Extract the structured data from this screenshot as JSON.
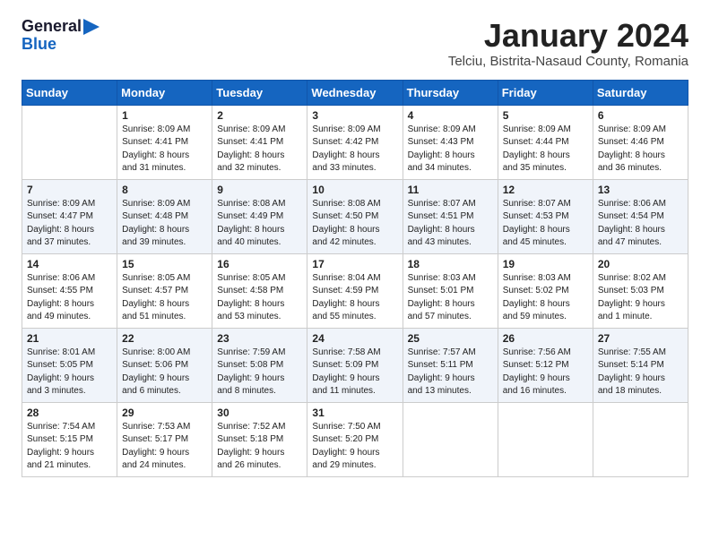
{
  "logo": {
    "line1": "General",
    "line2": "Blue"
  },
  "title": "January 2024",
  "location": "Telciu, Bistrita-Nasaud County, Romania",
  "headers": [
    "Sunday",
    "Monday",
    "Tuesday",
    "Wednesday",
    "Thursday",
    "Friday",
    "Saturday"
  ],
  "weeks": [
    [
      {
        "day": "",
        "info": ""
      },
      {
        "day": "1",
        "info": "Sunrise: 8:09 AM\nSunset: 4:41 PM\nDaylight: 8 hours\nand 31 minutes."
      },
      {
        "day": "2",
        "info": "Sunrise: 8:09 AM\nSunset: 4:41 PM\nDaylight: 8 hours\nand 32 minutes."
      },
      {
        "day": "3",
        "info": "Sunrise: 8:09 AM\nSunset: 4:42 PM\nDaylight: 8 hours\nand 33 minutes."
      },
      {
        "day": "4",
        "info": "Sunrise: 8:09 AM\nSunset: 4:43 PM\nDaylight: 8 hours\nand 34 minutes."
      },
      {
        "day": "5",
        "info": "Sunrise: 8:09 AM\nSunset: 4:44 PM\nDaylight: 8 hours\nand 35 minutes."
      },
      {
        "day": "6",
        "info": "Sunrise: 8:09 AM\nSunset: 4:46 PM\nDaylight: 8 hours\nand 36 minutes."
      }
    ],
    [
      {
        "day": "7",
        "info": "Sunrise: 8:09 AM\nSunset: 4:47 PM\nDaylight: 8 hours\nand 37 minutes."
      },
      {
        "day": "8",
        "info": "Sunrise: 8:09 AM\nSunset: 4:48 PM\nDaylight: 8 hours\nand 39 minutes."
      },
      {
        "day": "9",
        "info": "Sunrise: 8:08 AM\nSunset: 4:49 PM\nDaylight: 8 hours\nand 40 minutes."
      },
      {
        "day": "10",
        "info": "Sunrise: 8:08 AM\nSunset: 4:50 PM\nDaylight: 8 hours\nand 42 minutes."
      },
      {
        "day": "11",
        "info": "Sunrise: 8:07 AM\nSunset: 4:51 PM\nDaylight: 8 hours\nand 43 minutes."
      },
      {
        "day": "12",
        "info": "Sunrise: 8:07 AM\nSunset: 4:53 PM\nDaylight: 8 hours\nand 45 minutes."
      },
      {
        "day": "13",
        "info": "Sunrise: 8:06 AM\nSunset: 4:54 PM\nDaylight: 8 hours\nand 47 minutes."
      }
    ],
    [
      {
        "day": "14",
        "info": "Sunrise: 8:06 AM\nSunset: 4:55 PM\nDaylight: 8 hours\nand 49 minutes."
      },
      {
        "day": "15",
        "info": "Sunrise: 8:05 AM\nSunset: 4:57 PM\nDaylight: 8 hours\nand 51 minutes."
      },
      {
        "day": "16",
        "info": "Sunrise: 8:05 AM\nSunset: 4:58 PM\nDaylight: 8 hours\nand 53 minutes."
      },
      {
        "day": "17",
        "info": "Sunrise: 8:04 AM\nSunset: 4:59 PM\nDaylight: 8 hours\nand 55 minutes."
      },
      {
        "day": "18",
        "info": "Sunrise: 8:03 AM\nSunset: 5:01 PM\nDaylight: 8 hours\nand 57 minutes."
      },
      {
        "day": "19",
        "info": "Sunrise: 8:03 AM\nSunset: 5:02 PM\nDaylight: 8 hours\nand 59 minutes."
      },
      {
        "day": "20",
        "info": "Sunrise: 8:02 AM\nSunset: 5:03 PM\nDaylight: 9 hours\nand 1 minute."
      }
    ],
    [
      {
        "day": "21",
        "info": "Sunrise: 8:01 AM\nSunset: 5:05 PM\nDaylight: 9 hours\nand 3 minutes."
      },
      {
        "day": "22",
        "info": "Sunrise: 8:00 AM\nSunset: 5:06 PM\nDaylight: 9 hours\nand 6 minutes."
      },
      {
        "day": "23",
        "info": "Sunrise: 7:59 AM\nSunset: 5:08 PM\nDaylight: 9 hours\nand 8 minutes."
      },
      {
        "day": "24",
        "info": "Sunrise: 7:58 AM\nSunset: 5:09 PM\nDaylight: 9 hours\nand 11 minutes."
      },
      {
        "day": "25",
        "info": "Sunrise: 7:57 AM\nSunset: 5:11 PM\nDaylight: 9 hours\nand 13 minutes."
      },
      {
        "day": "26",
        "info": "Sunrise: 7:56 AM\nSunset: 5:12 PM\nDaylight: 9 hours\nand 16 minutes."
      },
      {
        "day": "27",
        "info": "Sunrise: 7:55 AM\nSunset: 5:14 PM\nDaylight: 9 hours\nand 18 minutes."
      }
    ],
    [
      {
        "day": "28",
        "info": "Sunrise: 7:54 AM\nSunset: 5:15 PM\nDaylight: 9 hours\nand 21 minutes."
      },
      {
        "day": "29",
        "info": "Sunrise: 7:53 AM\nSunset: 5:17 PM\nDaylight: 9 hours\nand 24 minutes."
      },
      {
        "day": "30",
        "info": "Sunrise: 7:52 AM\nSunset: 5:18 PM\nDaylight: 9 hours\nand 26 minutes."
      },
      {
        "day": "31",
        "info": "Sunrise: 7:50 AM\nSunset: 5:20 PM\nDaylight: 9 hours\nand 29 minutes."
      },
      {
        "day": "",
        "info": ""
      },
      {
        "day": "",
        "info": ""
      },
      {
        "day": "",
        "info": ""
      }
    ]
  ]
}
